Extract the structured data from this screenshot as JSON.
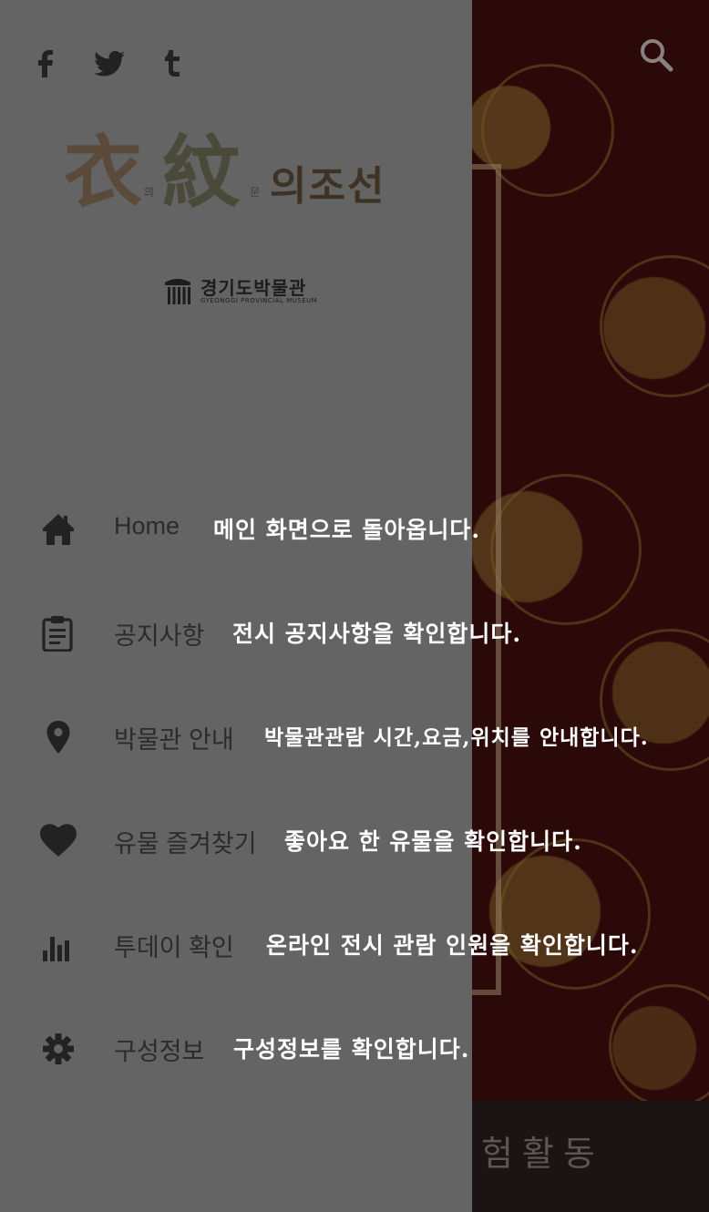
{
  "background": {
    "bottom_bar_text": "체험활동"
  },
  "drawer": {
    "social": [
      {
        "name": "facebook-icon"
      },
      {
        "name": "twitter-icon"
      },
      {
        "name": "tumblr-icon"
      }
    ],
    "logo": {
      "hanja_1": "衣",
      "small_1": "의",
      "hanja_2": "紋",
      "small_2": "문",
      "suffix": "의조선"
    },
    "museum": {
      "name": "경기도박물관",
      "name_en": "GYEONGGI PROVINCIAL MUSEUM"
    },
    "menu": [
      {
        "icon": "home-icon",
        "label": "Home",
        "desc": "메인 화면으로 돌아옵니다."
      },
      {
        "icon": "clipboard-icon",
        "label": "공지사항",
        "desc": "전시 공지사항을 확인합니다."
      },
      {
        "icon": "location-pin-icon",
        "label": "박물관 안내",
        "desc": "박물관관람 시간,요금,위치를 안내합니다."
      },
      {
        "icon": "heart-icon",
        "label": "유물 즐겨찾기",
        "desc": "좋아요 한 유물을 확인합니다."
      },
      {
        "icon": "bar-chart-icon",
        "label": "투데이 확인",
        "desc": "온라인 전시 관람 인원을 확인합니다."
      },
      {
        "icon": "gear-icon",
        "label": "구성정보",
        "desc": "구성정보를 확인합니다."
      }
    ]
  },
  "colors": {
    "drawer_bg": "#646464",
    "icon": "#222222",
    "desc_text": "#ffffff",
    "background": "#2b0909"
  }
}
